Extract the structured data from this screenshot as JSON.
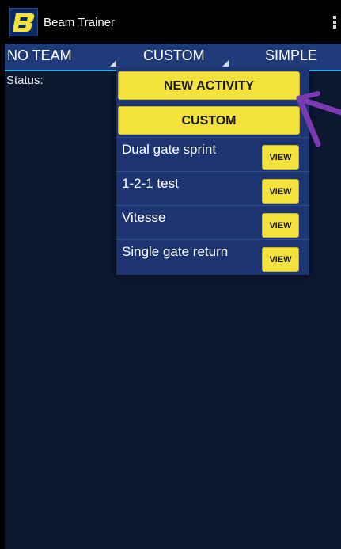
{
  "app": {
    "title": "Beam Trainer",
    "logo_letter": "B"
  },
  "spinners": {
    "team": "NO TEAM",
    "mode": "CUSTOM",
    "view": "SIMPLE"
  },
  "status": {
    "label": "Status:"
  },
  "dropdown": {
    "new_activity": "NEW ACTIVITY",
    "custom": "CUSTOM",
    "items": [
      {
        "label": "Dual gate sprint",
        "button": "VIEW"
      },
      {
        "label": "1-2-1 test",
        "button": "VIEW"
      },
      {
        "label": "Vitesse",
        "button": "VIEW"
      },
      {
        "label": "Single gate return",
        "button": "VIEW"
      }
    ]
  },
  "colors": {
    "background": "#0c1730",
    "spinner_bar": "#1f3b7a",
    "accent_yellow": "#f4e23c",
    "annotation_arrow": "#7a3ab0"
  }
}
